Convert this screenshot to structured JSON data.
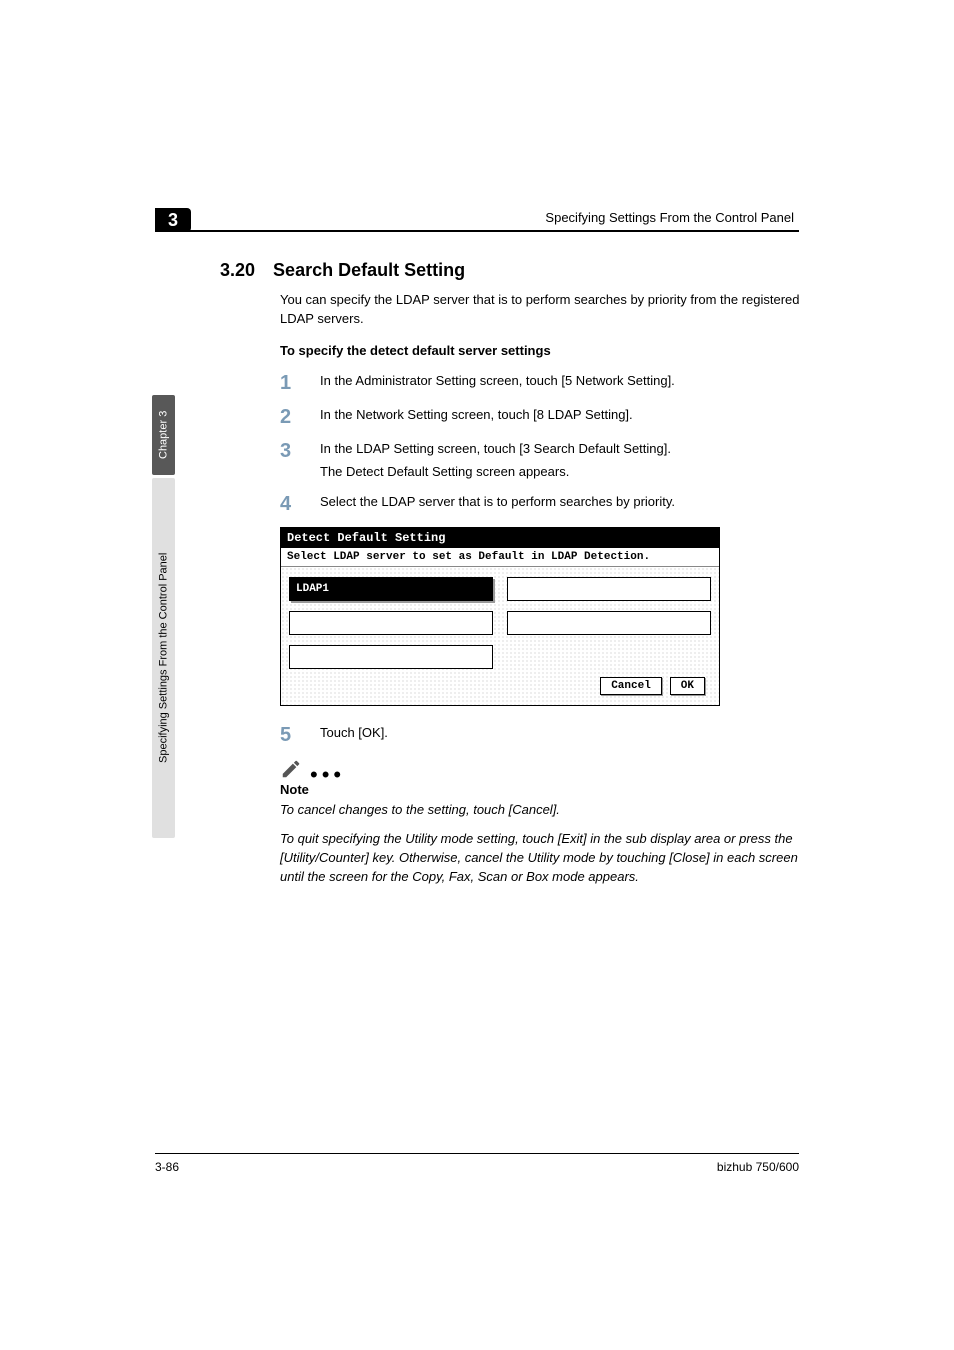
{
  "header": {
    "chapter_badge": "3",
    "running_title": "Specifying Settings From the Control Panel"
  },
  "side_tab": {
    "dark": "Chapter 3",
    "light": "Specifying Settings From the Control Panel"
  },
  "section": {
    "number": "3.20",
    "title": "Search Default Setting",
    "intro": "You can specify the LDAP server that is to perform searches by priority from the registered LDAP servers.",
    "sub_head": "To specify the detect default server settings"
  },
  "steps": [
    {
      "num": "1",
      "text": "In the Administrator Setting screen, touch [5 Network Setting]."
    },
    {
      "num": "2",
      "text": "In the Network Setting screen, touch [8 LDAP Setting]."
    },
    {
      "num": "3",
      "text": "In the LDAP Setting screen, touch [3 Search Default Setting].",
      "sub": "The Detect Default Setting screen appears."
    },
    {
      "num": "4",
      "text": "Select the LDAP server that is to perform searches by priority."
    },
    {
      "num": "5",
      "text": "Touch [OK]."
    }
  ],
  "figure": {
    "title": "Detect Default Setting",
    "subtitle": "Select LDAP server to set as Default in LDAP Detection.",
    "slots": [
      "LDAP1",
      "",
      "",
      "",
      ""
    ],
    "cancel": "Cancel",
    "ok": "OK"
  },
  "note": {
    "label": "Note",
    "p1": "To cancel changes to the setting, touch [Cancel].",
    "p2": "To quit specifying the Utility mode setting, touch [Exit] in the sub display area or press the [Utility/Counter] key. Otherwise, cancel the Utility mode by touching [Close] in each screen until the screen for the Copy, Fax, Scan or Box mode appears."
  },
  "footer": {
    "left": "3-86",
    "right": "bizhub 750/600"
  }
}
